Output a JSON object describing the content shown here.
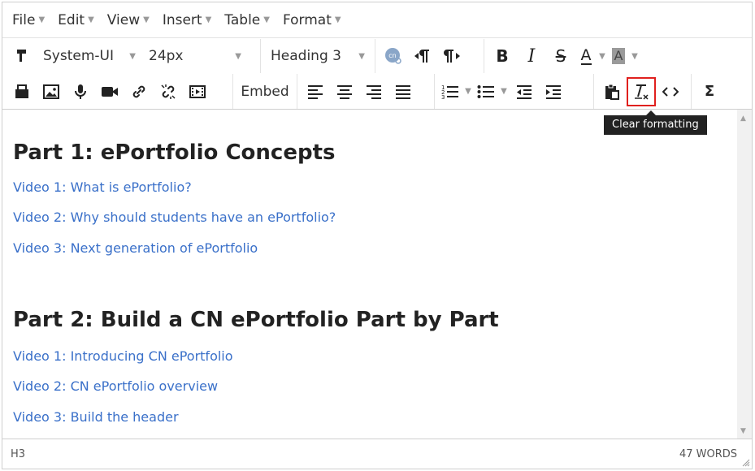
{
  "menubar": {
    "items": [
      "File",
      "Edit",
      "View",
      "Insert",
      "Table",
      "Format"
    ]
  },
  "toolbar": {
    "font_family": "System-UI",
    "font_size": "24px",
    "block_format": "Heading 3",
    "embed_label": "Embed"
  },
  "tooltip": "Clear formatting",
  "content": {
    "heading1": "Part 1: ePortfolio Concepts",
    "links1": [
      "Video 1: What is ePortfolio?",
      "Video 2: Why should students have an ePortfolio?",
      "Video 3: Next generation of ePortfolio"
    ],
    "heading2": "Part 2: Build a CN ePortfolio Part by Part",
    "links2": [
      "Video 1: Introducing CN ePortfolio",
      "Video 2: CN ePortfolio overview",
      "Video 3: Build the header"
    ]
  },
  "status": {
    "path": "H3",
    "word_count": "47 WORDS"
  },
  "colors": {
    "link": "#3a70c9",
    "highlight_border": "#e0201e",
    "tooltip_bg": "#222222"
  }
}
